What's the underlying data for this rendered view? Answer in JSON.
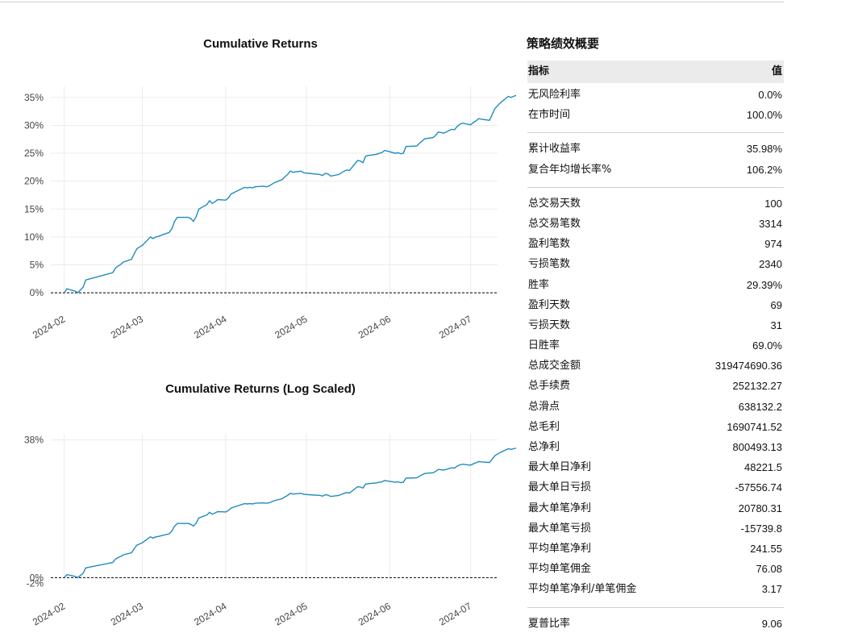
{
  "colors": {
    "line": "#1f8bbd",
    "grid": "#ebebeb",
    "zero_line": "#000000",
    "header_bg": "#ebebeb"
  },
  "chart_data": [
    {
      "type": "line",
      "title": "Cumulative Returns",
      "xlabel": "",
      "ylabel": "",
      "x_ticks": [
        "2024-02",
        "2024-03",
        "2024-04",
        "2024-05",
        "2024-06",
        "2024-07"
      ],
      "y_ticks": [
        "0%",
        "5%",
        "10%",
        "15%",
        "20%",
        "25%",
        "30%",
        "35%"
      ],
      "ylim": [
        -0.01,
        0.37
      ],
      "xlim": [
        "2024-01-27",
        "2024-07-11"
      ],
      "grid": true,
      "zero_line": "dashed",
      "series": [
        {
          "points": [
            [
              "2024-02-01",
              0.0
            ],
            [
              "2024-02-02",
              0.007
            ],
            [
              "2024-02-05",
              0.003
            ],
            [
              "2024-02-06",
              0.0
            ],
            [
              "2024-02-07",
              0.005
            ],
            [
              "2024-02-08",
              0.01
            ],
            [
              "2024-02-09",
              0.023
            ],
            [
              "2024-02-19",
              0.036
            ],
            [
              "2024-02-20",
              0.044
            ],
            [
              "2024-02-21",
              0.048
            ],
            [
              "2024-02-22",
              0.051
            ],
            [
              "2024-02-23",
              0.055
            ],
            [
              "2024-02-26",
              0.06
            ],
            [
              "2024-02-27",
              0.07
            ],
            [
              "2024-02-28",
              0.079
            ],
            [
              "2024-02-29",
              0.082
            ],
            [
              "2024-03-01",
              0.085
            ],
            [
              "2024-03-04",
              0.1
            ],
            [
              "2024-03-05",
              0.097
            ],
            [
              "2024-03-06",
              0.1
            ],
            [
              "2024-03-07",
              0.101
            ],
            [
              "2024-03-08",
              0.103
            ],
            [
              "2024-03-11",
              0.108
            ],
            [
              "2024-03-12",
              0.115
            ],
            [
              "2024-03-13",
              0.128
            ],
            [
              "2024-03-14",
              0.135
            ],
            [
              "2024-03-15",
              0.135
            ],
            [
              "2024-03-18",
              0.135
            ],
            [
              "2024-03-19",
              0.133
            ],
            [
              "2024-03-20",
              0.128
            ],
            [
              "2024-03-21",
              0.136
            ],
            [
              "2024-03-22",
              0.15
            ],
            [
              "2024-03-25",
              0.158
            ],
            [
              "2024-03-26",
              0.165
            ],
            [
              "2024-03-27",
              0.16
            ],
            [
              "2024-03-28",
              0.163
            ],
            [
              "2024-03-29",
              0.167
            ],
            [
              "2024-04-01",
              0.166
            ],
            [
              "2024-04-02",
              0.17
            ],
            [
              "2024-04-03",
              0.177
            ],
            [
              "2024-04-08",
              0.189
            ],
            [
              "2024-04-09",
              0.188
            ],
            [
              "2024-04-10",
              0.189
            ],
            [
              "2024-04-11",
              0.188
            ],
            [
              "2024-04-12",
              0.19
            ],
            [
              "2024-04-15",
              0.191
            ],
            [
              "2024-04-16",
              0.19
            ],
            [
              "2024-04-17",
              0.191
            ],
            [
              "2024-04-18",
              0.194
            ],
            [
              "2024-04-19",
              0.197
            ],
            [
              "2024-04-22",
              0.203
            ],
            [
              "2024-04-23",
              0.208
            ],
            [
              "2024-04-24",
              0.212
            ],
            [
              "2024-04-25",
              0.218
            ],
            [
              "2024-04-26",
              0.216
            ],
            [
              "2024-04-29",
              0.218
            ],
            [
              "2024-04-30",
              0.215
            ],
            [
              "2024-05-06",
              0.212
            ],
            [
              "2024-05-07",
              0.21
            ],
            [
              "2024-05-08",
              0.214
            ],
            [
              "2024-05-09",
              0.213
            ],
            [
              "2024-05-10",
              0.209
            ],
            [
              "2024-05-13",
              0.212
            ],
            [
              "2024-05-14",
              0.215
            ],
            [
              "2024-05-15",
              0.218
            ],
            [
              "2024-05-16",
              0.22
            ],
            [
              "2024-05-17",
              0.219
            ],
            [
              "2024-05-20",
              0.237
            ],
            [
              "2024-05-21",
              0.236
            ],
            [
              "2024-05-22",
              0.233
            ],
            [
              "2024-05-23",
              0.245
            ],
            [
              "2024-05-24",
              0.246
            ],
            [
              "2024-05-27",
              0.248
            ],
            [
              "2024-05-28",
              0.25
            ],
            [
              "2024-05-29",
              0.251
            ],
            [
              "2024-05-30",
              0.255
            ],
            [
              "2024-05-31",
              0.254
            ],
            [
              "2024-06-03",
              0.25
            ],
            [
              "2024-06-04",
              0.251
            ],
            [
              "2024-06-05",
              0.249
            ],
            [
              "2024-06-06",
              0.25
            ],
            [
              "2024-06-07",
              0.262
            ],
            [
              "2024-06-11",
              0.263
            ],
            [
              "2024-06-12",
              0.268
            ],
            [
              "2024-06-13",
              0.272
            ],
            [
              "2024-06-14",
              0.276
            ],
            [
              "2024-06-17",
              0.278
            ],
            [
              "2024-06-18",
              0.282
            ],
            [
              "2024-06-19",
              0.288
            ],
            [
              "2024-06-20",
              0.287
            ],
            [
              "2024-06-21",
              0.286
            ],
            [
              "2024-06-24",
              0.293
            ],
            [
              "2024-06-25",
              0.292
            ],
            [
              "2024-06-26",
              0.298
            ],
            [
              "2024-06-27",
              0.302
            ],
            [
              "2024-06-28",
              0.304
            ],
            [
              "2024-07-01",
              0.301
            ],
            [
              "2024-07-02",
              0.305
            ],
            [
              "2024-07-03",
              0.308
            ],
            [
              "2024-07-04",
              0.312
            ],
            [
              "2024-07-05",
              0.311
            ],
            [
              "2024-07-08",
              0.309
            ],
            [
              "2024-07-09",
              0.319
            ],
            [
              "2024-07-10",
              0.33
            ],
            [
              "2024-07-11",
              0.335
            ],
            [
              "2024-07-12",
              0.34
            ],
            [
              "2024-07-15",
              0.352
            ],
            [
              "2024-07-16",
              0.35
            ],
            [
              "2024-07-17",
              0.352
            ],
            [
              "2024-07-18",
              0.354
            ],
            [
              "2024-07-19",
              0.356
            ],
            [
              "2024-07-22",
              0.365
            ],
            [
              "2024-07-23",
              0.367
            ],
            [
              "2024-07-24",
              0.358
            ],
            [
              "2024-07-25",
              0.36
            ]
          ]
        }
      ]
    },
    {
      "type": "line",
      "title": "Cumulative Returns (Log Scaled)",
      "xlabel": "",
      "ylabel": "",
      "y_scale": "log",
      "x_ticks": [
        "2024-02",
        "2024-03",
        "2024-04",
        "2024-05",
        "2024-06",
        "2024-07"
      ],
      "y_ticks": [
        "38%",
        "0%",
        "-2%"
      ],
      "grid": true,
      "zero_line": "dashed",
      "series_ref": "same as Cumulative Returns series"
    }
  ],
  "perf_table": {
    "title": "策略绩效概要",
    "header": {
      "metric": "指标",
      "value": "值"
    },
    "groups": [
      [
        {
          "label": "无风险利率",
          "value": "0.0%"
        },
        {
          "label": "在市时间",
          "value": "100.0%"
        }
      ],
      [
        {
          "label": "累计收益率",
          "value": "35.98%"
        },
        {
          "label": "复合年均增长率%",
          "value": "106.2%"
        }
      ],
      [
        {
          "label": "总交易天数",
          "value": "100"
        },
        {
          "label": "总交易笔数",
          "value": "3314"
        },
        {
          "label": "盈利笔数",
          "value": "974"
        },
        {
          "label": "亏损笔数",
          "value": "2340"
        },
        {
          "label": "胜率",
          "value": "29.39%"
        },
        {
          "label": "盈利天数",
          "value": "69"
        },
        {
          "label": "亏损天数",
          "value": "31"
        },
        {
          "label": "日胜率",
          "value": "69.0%"
        },
        {
          "label": "总成交金额",
          "value": "319474690.36"
        },
        {
          "label": "总手续费",
          "value": "252132.27"
        },
        {
          "label": "总滑点",
          "value": "638132.2"
        },
        {
          "label": "总毛利",
          "value": "1690741.52"
        },
        {
          "label": "总净利",
          "value": "800493.13"
        },
        {
          "label": "最大单日净利",
          "value": "48221.5"
        },
        {
          "label": "最大单日亏损",
          "value": "-57556.74"
        },
        {
          "label": "最大单笔净利",
          "value": "20780.31"
        },
        {
          "label": "最大单笔亏损",
          "value": "-15739.8"
        },
        {
          "label": "平均单笔净利",
          "value": "241.55"
        },
        {
          "label": "平均单笔佣金",
          "value": "76.08"
        },
        {
          "label": "平均单笔净利/单笔佣金",
          "value": "3.17"
        }
      ],
      [
        {
          "label": "夏普比率",
          "value": "9.06"
        }
      ]
    ]
  }
}
